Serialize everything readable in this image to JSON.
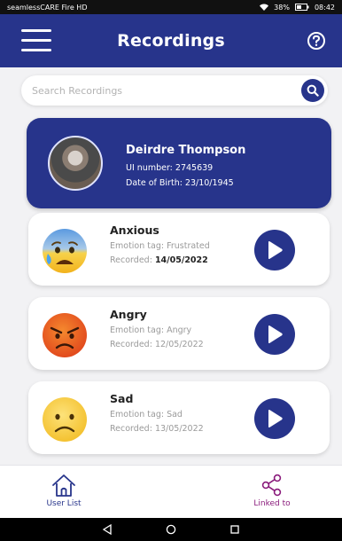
{
  "status_bar": {
    "carrier": "seamlessCARE Fire HD",
    "battery": "38%",
    "time": "08:42"
  },
  "header": {
    "title": "Recordings",
    "menu_icon": "hamburger-menu-icon",
    "help_icon": "help-circle-icon"
  },
  "search": {
    "placeholder": "Search Recordings",
    "value": ""
  },
  "patient": {
    "name": "Deirdre Thompson",
    "ui_number": "UI number: 2745639",
    "dob": "Date of Birth: 23/10/1945"
  },
  "recordings": [
    {
      "emotion": "Anxious",
      "tag": "Emotion tag: Frustrated",
      "recorded_label": "Recorded:",
      "recorded_date": "14/05/2022",
      "emoji": "anxious-emoji-icon"
    },
    {
      "emotion": "Angry",
      "tag": "Emotion tag: Angry",
      "recorded_label": "Recorded:",
      "recorded_date": "12/05/2022",
      "emoji": "angry-emoji-icon"
    },
    {
      "emotion": "Sad",
      "tag": "Emotion tag: Sad",
      "recorded_label": "Recorded:",
      "recorded_date": "13/05/2022",
      "emoji": "sad-emoji-icon"
    }
  ],
  "bottom_nav": {
    "user_list": "User List",
    "linked_to": "Linked to"
  },
  "colors": {
    "primary": "#27348b",
    "linked_accent": "#8a1c7c",
    "background": "#f2f2f4"
  }
}
